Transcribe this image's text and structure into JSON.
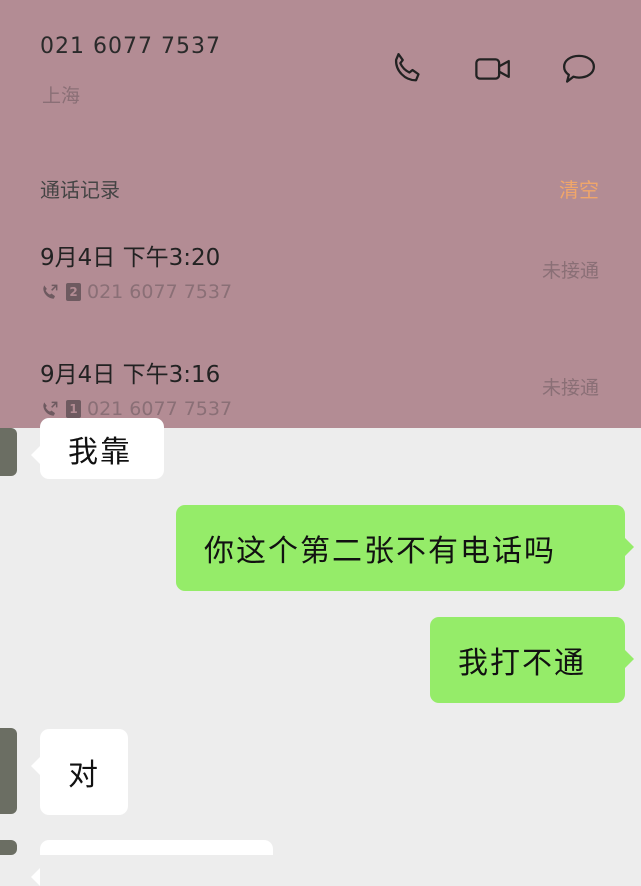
{
  "contact": {
    "number": "021 6077 7537",
    "location": "上海"
  },
  "actions": {
    "call_icon": "phone-icon",
    "video_icon": "video-camera-icon",
    "message_icon": "chat-bubble-icon"
  },
  "call_log": {
    "title": "通话记录",
    "clear_label": "清空",
    "records": [
      {
        "date": "9月4日  下午3:20",
        "sim": "2",
        "number": "021 6077 7537",
        "status": "未接通"
      },
      {
        "date": "9月4日  下午3:16",
        "sim": "1",
        "number": "021 6077 7537",
        "status": "未接通"
      }
    ]
  },
  "chat": {
    "messages": [
      {
        "side": "in",
        "text": "我靠"
      },
      {
        "side": "out",
        "text": "你这个第二张不有电话吗"
      },
      {
        "side": "out",
        "text": "我打不通"
      },
      {
        "side": "in",
        "text": "对"
      }
    ]
  },
  "colors": {
    "overlay": "#b38c94",
    "clear_accent": "#f0a66a",
    "outgoing_bubble": "#95ec69",
    "incoming_bubble": "#ffffff",
    "chat_background": "#ededed"
  }
}
